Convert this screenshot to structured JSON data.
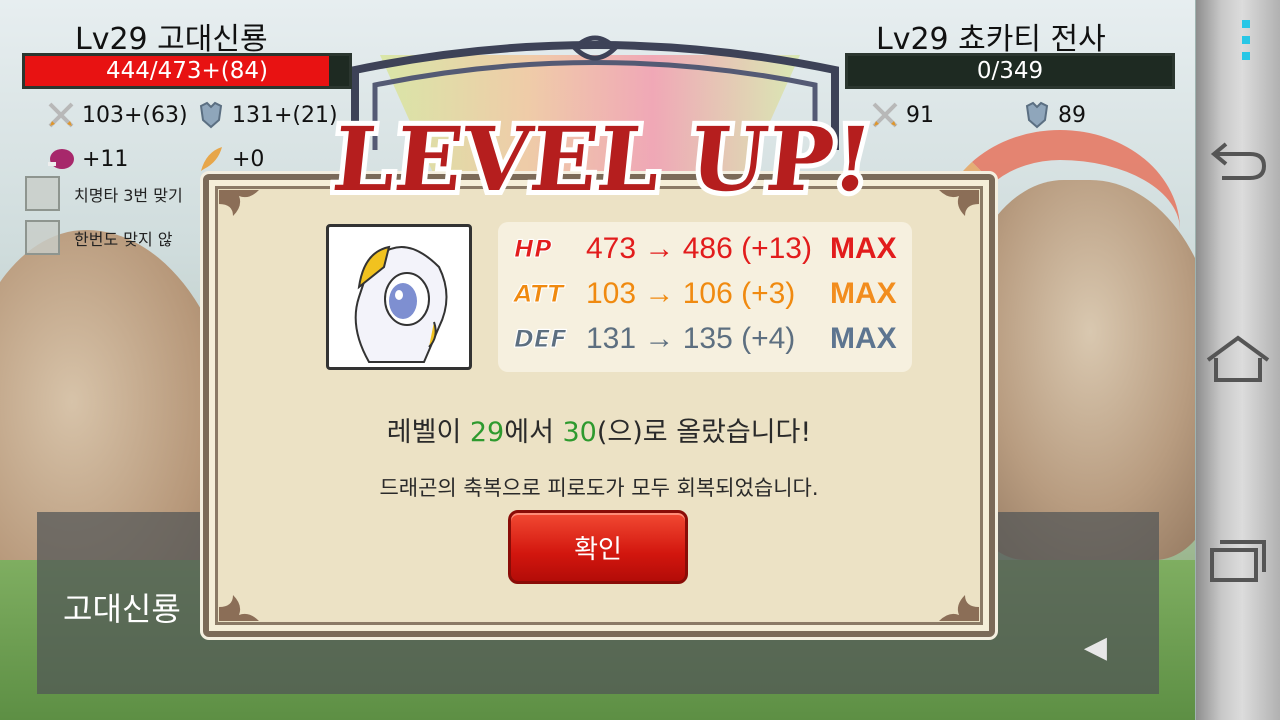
{
  "player": {
    "name": "Lv29 고대신룡",
    "hp_text": "444/473+(84)",
    "hp_fraction": 0.939,
    "attack": "103+(63)",
    "defense": "131+(21)",
    "bonus_1": "+11",
    "bonus_2": "+0"
  },
  "enemy": {
    "name": "Lv29 쵸카티 전사",
    "hp_text": "0/349",
    "hp_fraction": 0,
    "attack": "91",
    "defense": "89"
  },
  "options": [
    {
      "label": "치명타 3번 맞기"
    },
    {
      "label": "한번도 맞지 않"
    }
  ],
  "message_box": {
    "speaker": "고대신룡",
    "next_glyph": "◀"
  },
  "dialog": {
    "banner": "LEVEL UP!",
    "stats": [
      {
        "label": "HP",
        "value": "473 → 486 (+13)",
        "max": "MAX",
        "color": "#e21c1c",
        "label_color": "#e21c1c",
        "max_color": "#e21c1c"
      },
      {
        "label": "ATT",
        "value": "103 → 106 (+3)",
        "max": "MAX",
        "color": "#f08a10",
        "label_color": "#f08a10",
        "max_color": "#f28d1e"
      },
      {
        "label": "DEF",
        "value": "131 → 135 (+4)",
        "max": "MAX",
        "color": "#5d6f80",
        "label_color": "#5d6f80",
        "max_color": "#5d7590"
      }
    ],
    "message_line1_parts": [
      "레벨이 ",
      "29",
      "에서 ",
      "30",
      "(으)로 올랐습니다!"
    ],
    "message_line2": "드래곤의 축복으로 피로도가 모두 회복되었습니다.",
    "confirm_label": "확인"
  },
  "colors": {
    "hp_fill": "#e81212",
    "level_highlight": "#2e9a2e",
    "confirm_button": "#d2160e"
  }
}
